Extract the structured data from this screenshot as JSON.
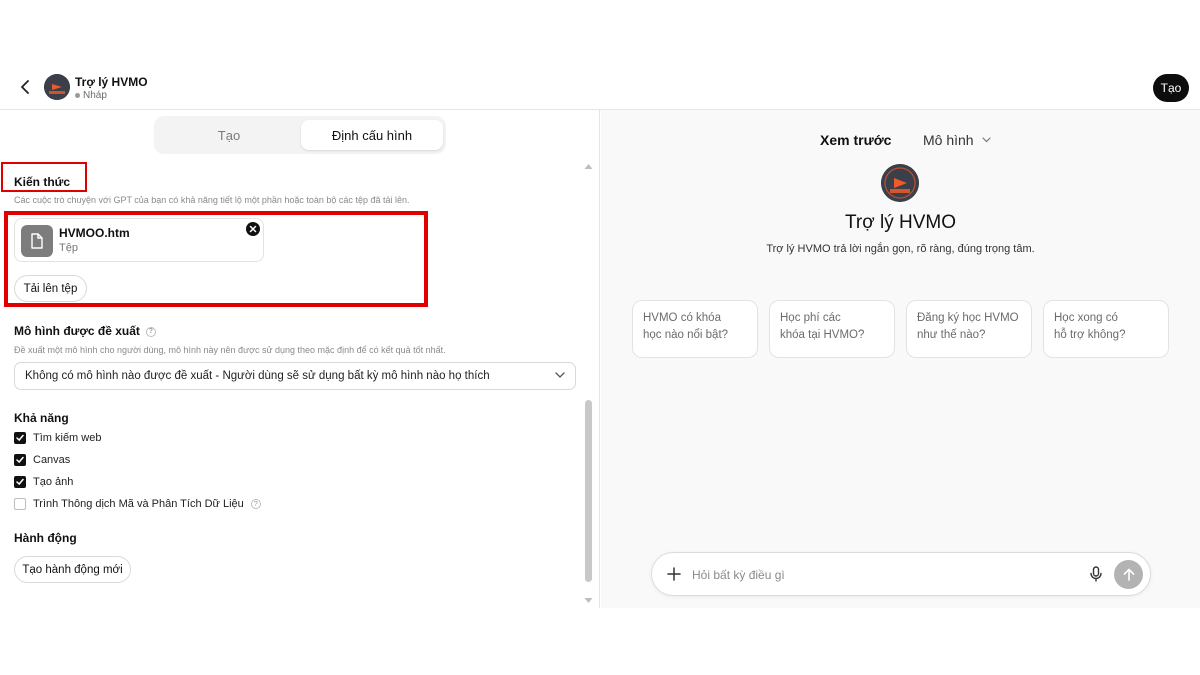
{
  "header": {
    "gpt_name": "Trợ lý HVMO",
    "status": "Nháp",
    "create_button": "Tạo"
  },
  "tabs": {
    "create": "Tạo",
    "configure": "Định cấu hình"
  },
  "knowledge": {
    "title": "Kiến thức",
    "description": "Các cuộc trò chuyện với GPT của bạn có khả năng tiết lộ một phần hoặc toàn bộ các tệp đã tải lên.",
    "file": {
      "name": "HVMOO.htm",
      "type": "Tệp"
    },
    "upload_button": "Tải lên tệp"
  },
  "recommended_model": {
    "title": "Mô hình được đề xuất",
    "description": "Đề xuất một mô hình cho người dùng, mô hình này nên được sử dụng theo mặc định để có kết quả tốt nhất.",
    "selected": "Không có mô hình nào được đề xuất - Người dùng sẽ sử dụng bất kỳ mô hình nào họ thích"
  },
  "capabilities": {
    "title": "Khả năng",
    "items": [
      {
        "label": "Tìm kiếm web",
        "checked": true
      },
      {
        "label": "Canvas",
        "checked": true
      },
      {
        "label": "Tạo ảnh",
        "checked": true
      },
      {
        "label": "Trình Thông dịch Mã và Phân Tích Dữ Liệu",
        "checked": false
      }
    ]
  },
  "actions": {
    "title": "Hành động",
    "new_action_button": "Tạo hành động mới"
  },
  "preview": {
    "label": "Xem trước",
    "model_label": "Mô hình",
    "gpt_name": "Trợ lý HVMO",
    "description": "Trợ lý HVMO trả lời ngắn gọn, rõ ràng, đúng trọng tâm.",
    "starters": [
      {
        "line1": "HVMO có khóa",
        "line2": "học nào nổi bật?"
      },
      {
        "line1": "Học phí các",
        "line2": "khóa tại HVMO?"
      },
      {
        "line1": "Đăng ký học HVMO",
        "line2": "như thế nào?"
      },
      {
        "line1": "Học xong có",
        "line2": "hỗ trợ không?"
      }
    ],
    "composer_placeholder": "Hỏi bất kỳ điều gì"
  },
  "colors": {
    "highlight": "#e00000",
    "brand_avatar_bg": "#3a3f4a",
    "brand_logo_accent": "#f05a28"
  }
}
